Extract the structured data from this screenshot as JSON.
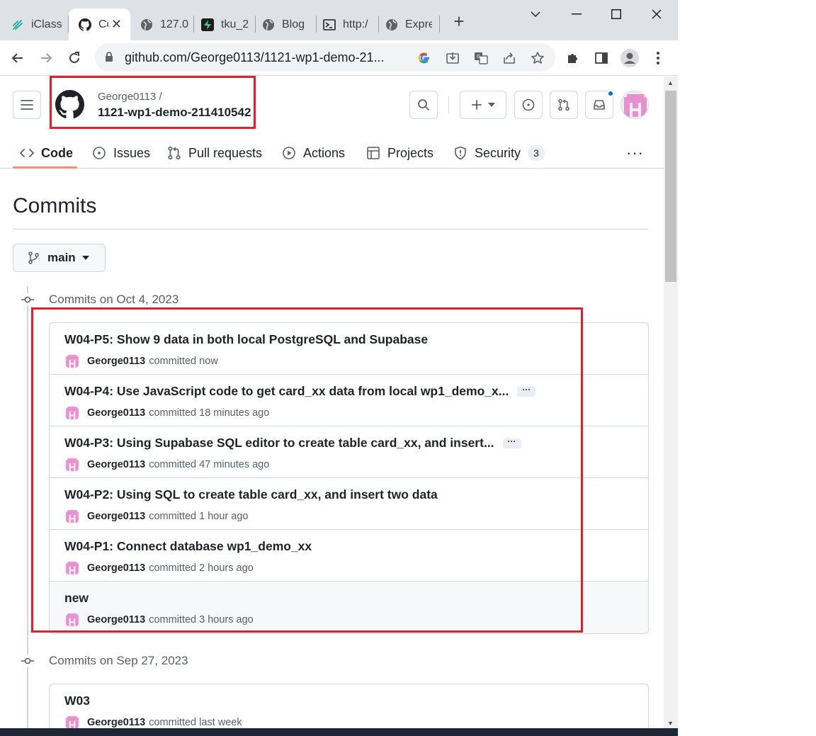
{
  "browser": {
    "tabs": [
      {
        "title": "iClass",
        "icon": "iclass-icon"
      },
      {
        "title": "Co",
        "icon": "github-icon"
      },
      {
        "title": "127.0",
        "icon": "globe-icon"
      },
      {
        "title": "tku_2",
        "icon": "supabase-icon"
      },
      {
        "title": "Blog",
        "icon": "globe-icon"
      },
      {
        "title": "http:/",
        "icon": "terminal-icon"
      },
      {
        "title": "Expre",
        "icon": "globe-icon"
      }
    ],
    "url": "github.com/George0113/1121-wp1-demo-21..."
  },
  "header": {
    "owner": "George0113 /",
    "repo": "1121-wp1-demo-211410542"
  },
  "repo_nav": {
    "code": "Code",
    "issues": "Issues",
    "pulls": "Pull requests",
    "actions": "Actions",
    "projects": "Projects",
    "security": "Security",
    "security_count": "3",
    "more": "···"
  },
  "page": {
    "title": "Commits",
    "branch": "main"
  },
  "groups": [
    {
      "title": "Commits on Oct 4, 2023",
      "commits": [
        {
          "message": "W04-P5: Show 9 data in both local PostgreSQL and Supabase",
          "author": "George0113",
          "time": "committed now",
          "truncated": false
        },
        {
          "message": "W04-P4: Use JavaScript code to get card_xx data from local wp1_demo_x...",
          "author": "George0113",
          "time": "committed 18 minutes ago",
          "truncated": true
        },
        {
          "message": "W04-P3: Using Supabase SQL editor to create table card_xx, and insert...",
          "author": "George0113",
          "time": "committed 47 minutes ago",
          "truncated": true
        },
        {
          "message": "W04-P2: Using SQL to create table card_xx, and insert two data",
          "author": "George0113",
          "time": "committed 1 hour ago",
          "truncated": false
        },
        {
          "message": "W04-P1: Connect database wp1_demo_xx",
          "author": "George0113",
          "time": "committed 2 hours ago",
          "truncated": false
        },
        {
          "message": "new",
          "author": "George0113",
          "time": "committed 3 hours ago",
          "truncated": false
        }
      ]
    },
    {
      "title": "Commits on Sep 27, 2023",
      "commits": [
        {
          "message": "W03",
          "author": "George0113",
          "time": "committed last week",
          "truncated": false
        }
      ]
    }
  ],
  "ellipsis_label": "···",
  "colors": {
    "annotation": "#e0202a",
    "avatar_pink": "#e88fcf",
    "accent_underline": "#fd8c73"
  }
}
